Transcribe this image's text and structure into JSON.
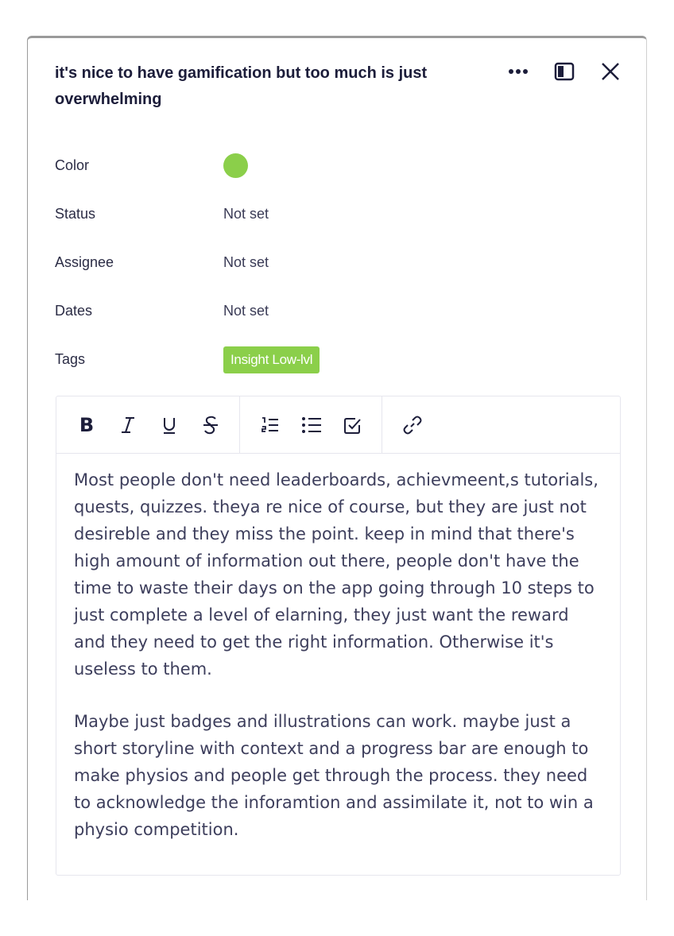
{
  "card": {
    "title": "it's nice to have gamification but too much is just overwhelming",
    "properties": {
      "color_label": "Color",
      "color_value": "#8bcf4a",
      "status_label": "Status",
      "status_value": "Not set",
      "assignee_label": "Assignee",
      "assignee_value": "Not set",
      "dates_label": "Dates",
      "dates_value": "Not set",
      "tags_label": "Tags",
      "tag_value": "Insight Low-lvl",
      "tag_color": "#8bcf4a"
    },
    "header_icons": [
      "more-icon",
      "sidebar-toggle-icon",
      "close-icon"
    ],
    "toolbar_icons": [
      "bold-icon",
      "italic-icon",
      "underline-icon",
      "strikethrough-icon",
      "numbered-list-icon",
      "bullet-list-icon",
      "checklist-icon",
      "link-icon"
    ],
    "toolbar": {
      "bold_label": "B"
    },
    "body": {
      "paragraph1": "Most people don't need leaderboards, achievmeent,s tutorials, quests, quizzes. theya re nice of course, but they are just not desireble and they miss the point. keep in mind that there's high amount of information out there, people don't have the time to waste their days on the app going through 10 steps to just complete a level of elarning, they just want the reward and they need to get the right information. Otherwise it's useless to them.",
      "paragraph2": "Maybe just badges and illustrations can work. maybe just a short storyline with context and a progress bar are enough to make physios and people get through the process. they need to acknowledge the inforamtion and assimilate it, not to win a physio competition."
    }
  }
}
